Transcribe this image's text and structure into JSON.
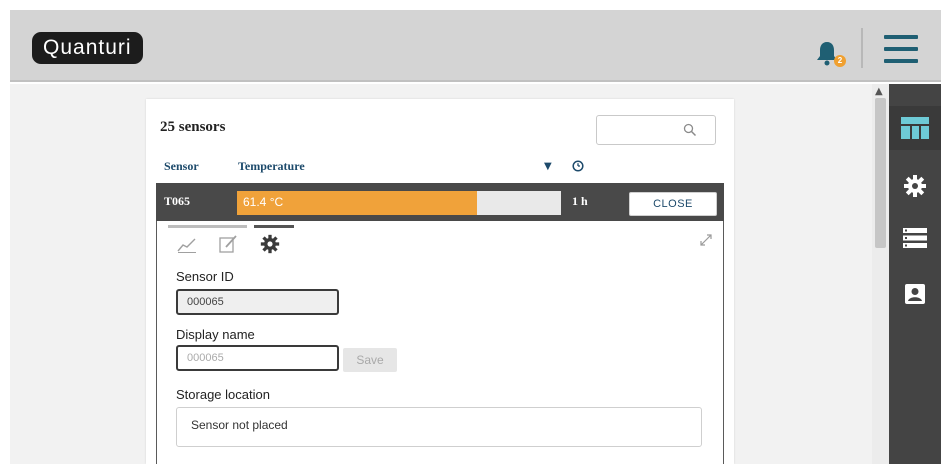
{
  "app": {
    "logo_text": "Quanturi",
    "notification_count": "2"
  },
  "colors": {
    "accent": "#1f5f73",
    "bar": "#f0a23a",
    "row_bg": "#494949",
    "rail_bg": "#444444"
  },
  "icons": {
    "topbar": [
      "bell-icon",
      "hamburger-menu-icon"
    ],
    "rail": [
      "dashboard-icon",
      "gear-icon",
      "list-icon",
      "contact-card-icon"
    ],
    "panel_tabs": [
      "chart-icon",
      "edit-icon",
      "gear-icon"
    ]
  },
  "sensors": {
    "count_label": "25 sensors",
    "search": {
      "value": "",
      "placeholder": ""
    },
    "columns": {
      "sensor": "Sensor",
      "metric": "Temperature"
    }
  },
  "row": {
    "id": "T065",
    "value_label": "61.4 °C",
    "level_fraction": 0.74,
    "age": "1 h",
    "close_label": "CLOSE"
  },
  "settings": {
    "sensor_id_label": "Sensor ID",
    "sensor_id_value": "000065",
    "display_name_label": "Display name",
    "display_name_placeholder": "000065",
    "save_label": "Save",
    "storage_location_label": "Storage location",
    "storage_location_value": "Sensor not placed"
  }
}
